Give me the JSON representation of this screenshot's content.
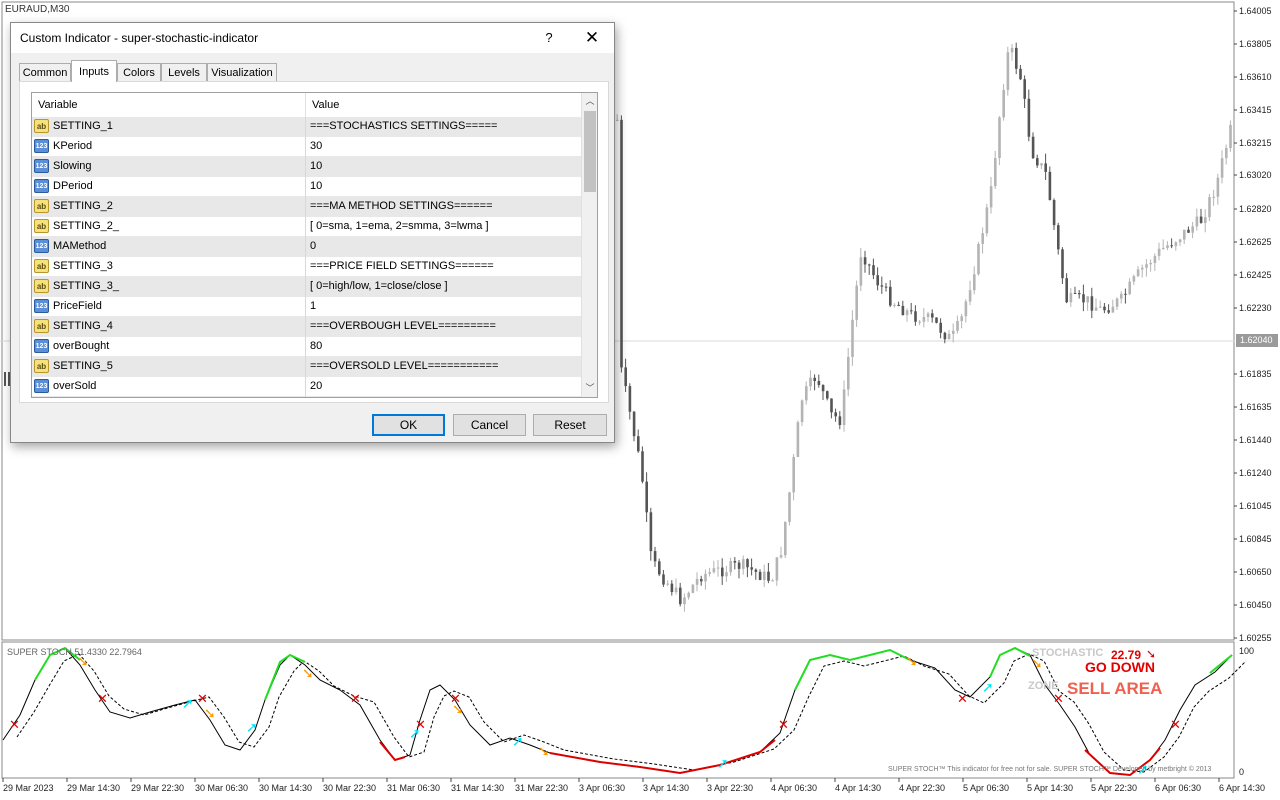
{
  "chart": {
    "symbol": "EURAUD,M30",
    "current_price": "1.62040",
    "price_scale": [
      "1.64005",
      "1.63805",
      "1.63610",
      "1.63415",
      "1.63215",
      "1.63020",
      "1.62820",
      "1.62625",
      "1.62425",
      "1.62230",
      "1.61835",
      "1.61635",
      "1.61440",
      "1.61240",
      "1.61045",
      "1.60845",
      "1.60650",
      "1.60450",
      "1.60255"
    ],
    "time_axis": [
      "29 Mar 2023",
      "29 Mar 14:30",
      "29 Mar 22:30",
      "30 Mar 06:30",
      "30 Mar 14:30",
      "30 Mar 22:30",
      "31 Mar 06:30",
      "31 Mar 14:30",
      "31 Mar 22:30",
      "3 Apr 06:30",
      "3 Apr 14:30",
      "3 Apr 22:30",
      "4 Apr 06:30",
      "4 Apr 14:30",
      "4 Apr 22:30",
      "5 Apr 06:30",
      "5 Apr 14:30",
      "5 Apr 22:30",
      "6 Apr 06:30",
      "6 Apr 14:30"
    ],
    "colors": {
      "bull_candle": "#b4b4b4",
      "bear_candle": "#555555",
      "grid": "#d8d8d8"
    }
  },
  "indicator": {
    "title": "SUPER STOCH 51.4330 22.7964",
    "scale_top": "100",
    "scale_bottom": "0",
    "value": "22.79",
    "stochastic_label": "STOCHASTIC",
    "zone_label": "ZONE",
    "go_down": "GO DOWN",
    "sell_area": "SELL AREA",
    "footer": "SUPER STOCH™ This indicator for free not for sale. SUPER STOCH™ Developed by metbright © 2013",
    "colors": {
      "overbought": "#22dd22",
      "oversold": "#dd0000",
      "buy_arrow": "#00e5ff",
      "sell_arrow": "#ff9900",
      "cross": "#e00000"
    }
  },
  "dialog": {
    "title": "Custom Indicator - super-stochastic-indicator",
    "help": "?",
    "close": "✕",
    "tabs": [
      "Common",
      "Inputs",
      "Colors",
      "Levels",
      "Visualization"
    ],
    "active_tab": "Inputs",
    "columns": {
      "variable": "Variable",
      "value": "Value"
    },
    "rows": [
      {
        "type": "ab",
        "variable": "SETTING_1",
        "value": "===STOCHASTICS SETTINGS====="
      },
      {
        "type": "123",
        "variable": "KPeriod",
        "value": "30"
      },
      {
        "type": "123",
        "variable": "Slowing",
        "value": "10"
      },
      {
        "type": "123",
        "variable": "DPeriod",
        "value": "10"
      },
      {
        "type": "ab",
        "variable": "SETTING_2",
        "value": "===MA METHOD SETTINGS======"
      },
      {
        "type": "ab",
        "variable": "SETTING_2_",
        "value": "[ 0=sma, 1=ema, 2=smma, 3=lwma ]"
      },
      {
        "type": "123",
        "variable": "MAMethod",
        "value": "0"
      },
      {
        "type": "ab",
        "variable": "SETTING_3",
        "value": "===PRICE FIELD SETTINGS======"
      },
      {
        "type": "ab",
        "variable": "SETTING_3_",
        "value": "[ 0=high/low, 1=close/close ]"
      },
      {
        "type": "123",
        "variable": "PriceField",
        "value": "1"
      },
      {
        "type": "ab",
        "variable": "SETTING_4",
        "value": "===OVERBOUGH LEVEL========="
      },
      {
        "type": "123",
        "variable": "overBought",
        "value": "80"
      },
      {
        "type": "ab",
        "variable": "SETTING_5",
        "value": "===OVERSOLD LEVEL==========="
      },
      {
        "type": "123",
        "variable": "overSold",
        "value": "20"
      }
    ],
    "buttons": {
      "ok": "OK",
      "cancel": "Cancel",
      "reset": "Reset"
    }
  }
}
